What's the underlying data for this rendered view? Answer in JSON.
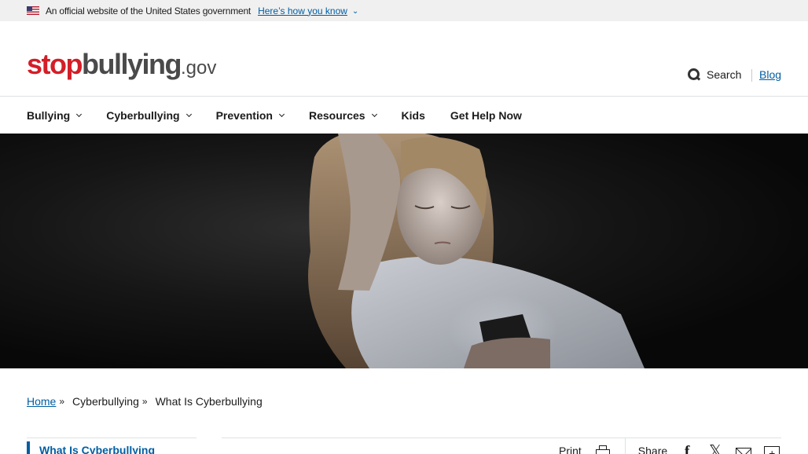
{
  "gov_banner": {
    "official_text": "An official website of the United States government",
    "how_you_know_link": "Here’s how you know"
  },
  "header": {
    "logo_stop": "stop",
    "logo_bullying": "bullying",
    "logo_gov": ".gov",
    "search_label": "Search",
    "blog_link": "Blog"
  },
  "nav": {
    "items": [
      {
        "label": "Bullying",
        "has_dropdown": true
      },
      {
        "label": "Cyberbullying",
        "has_dropdown": true
      },
      {
        "label": "Prevention",
        "has_dropdown": true
      },
      {
        "label": "Resources",
        "has_dropdown": true
      },
      {
        "label": "Kids",
        "has_dropdown": false
      },
      {
        "label": "Get Help Now",
        "has_dropdown": false
      }
    ]
  },
  "breadcrumb": {
    "home": "Home",
    "separator": "»",
    "parent": "Cyberbullying",
    "current": "What Is Cyberbullying"
  },
  "sidenav": {
    "current_item": "What Is Cyberbullying"
  },
  "share_bar": {
    "print_label": "Print",
    "share_label": "Share",
    "icons": [
      "print-icon",
      "facebook-icon",
      "x-icon",
      "email-icon",
      "more-share-icon"
    ]
  },
  "colors": {
    "link": "#005ea2",
    "brand_red": "#d31e28",
    "brand_gray": "#4a4a4a",
    "banner_bg": "#f0f0f0"
  }
}
